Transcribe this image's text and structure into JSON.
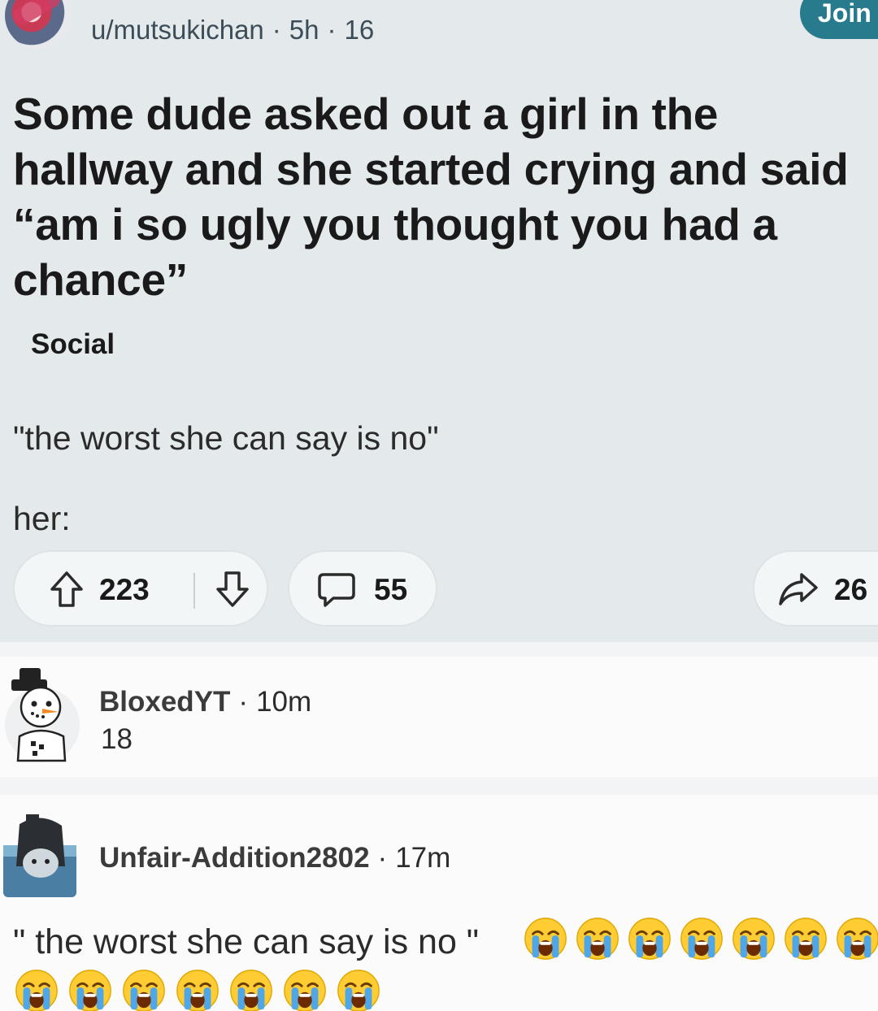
{
  "post": {
    "author": "u/mutsukichan",
    "age": "5h",
    "meta_count": "16",
    "join_label": "Join",
    "title": "Some dude asked out a girl in the hallway and she started crying and said “am i so ugly you thought you had a chance”",
    "flair": "Social",
    "body_line_1": "\"the worst she can say is no\"",
    "body_line_2": "her:",
    "upvotes": "223",
    "comments": "55",
    "shares": "26"
  },
  "comments": [
    {
      "author": "BloxedYT",
      "age": "10m",
      "text": "18",
      "avatar_icon": "snowman-avatar-icon"
    },
    {
      "author": "Unfair-Addition2802",
      "age": "17m",
      "text": "\" the worst she can say is no \"",
      "emoji": "😭",
      "emoji_count": 14,
      "avatar_icon": "ghost-avatar-icon"
    }
  ],
  "colors": {
    "post_bg": "#e4eaec",
    "join_button": "#287a8d",
    "comment_bg": "#fbfbfb"
  }
}
